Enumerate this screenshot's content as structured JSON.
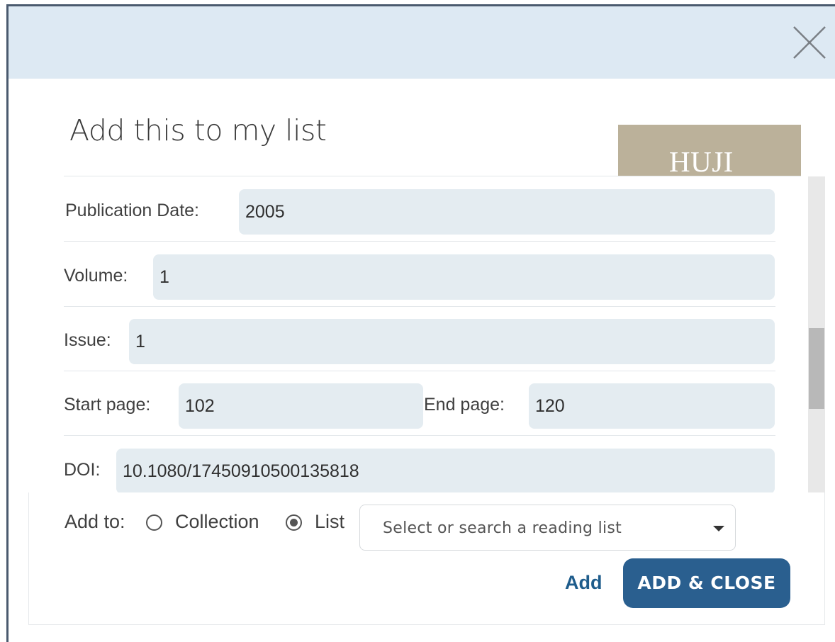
{
  "dialog": {
    "title": "Add this to my list",
    "close_icon": "close-icon",
    "logo_text": "HUJI",
    "colors": {
      "header_bg": "#dde9f3",
      "field_bg": "#e4ecf1",
      "primary": "#2a5f8f",
      "logo_bg": "#bbb19a"
    }
  },
  "fields": {
    "publication_date": {
      "label": "Publication Date:",
      "value": "2005"
    },
    "volume": {
      "label": "Volume:",
      "value": "1"
    },
    "issue": {
      "label": "Issue:",
      "value": "1"
    },
    "start_page": {
      "label": "Start page:",
      "value": "102"
    },
    "end_page": {
      "label": "End page:",
      "value": "120"
    },
    "doi": {
      "label": "DOI:",
      "value": "10.1080/17450910500135818"
    }
  },
  "footer": {
    "add_to_label": "Add to:",
    "options": [
      {
        "label": "Collection",
        "selected": false
      },
      {
        "label": "List",
        "selected": true
      }
    ],
    "reading_list_placeholder": "Select or search a reading list",
    "add_label": "Add",
    "add_close_label": "ADD & CLOSE"
  }
}
